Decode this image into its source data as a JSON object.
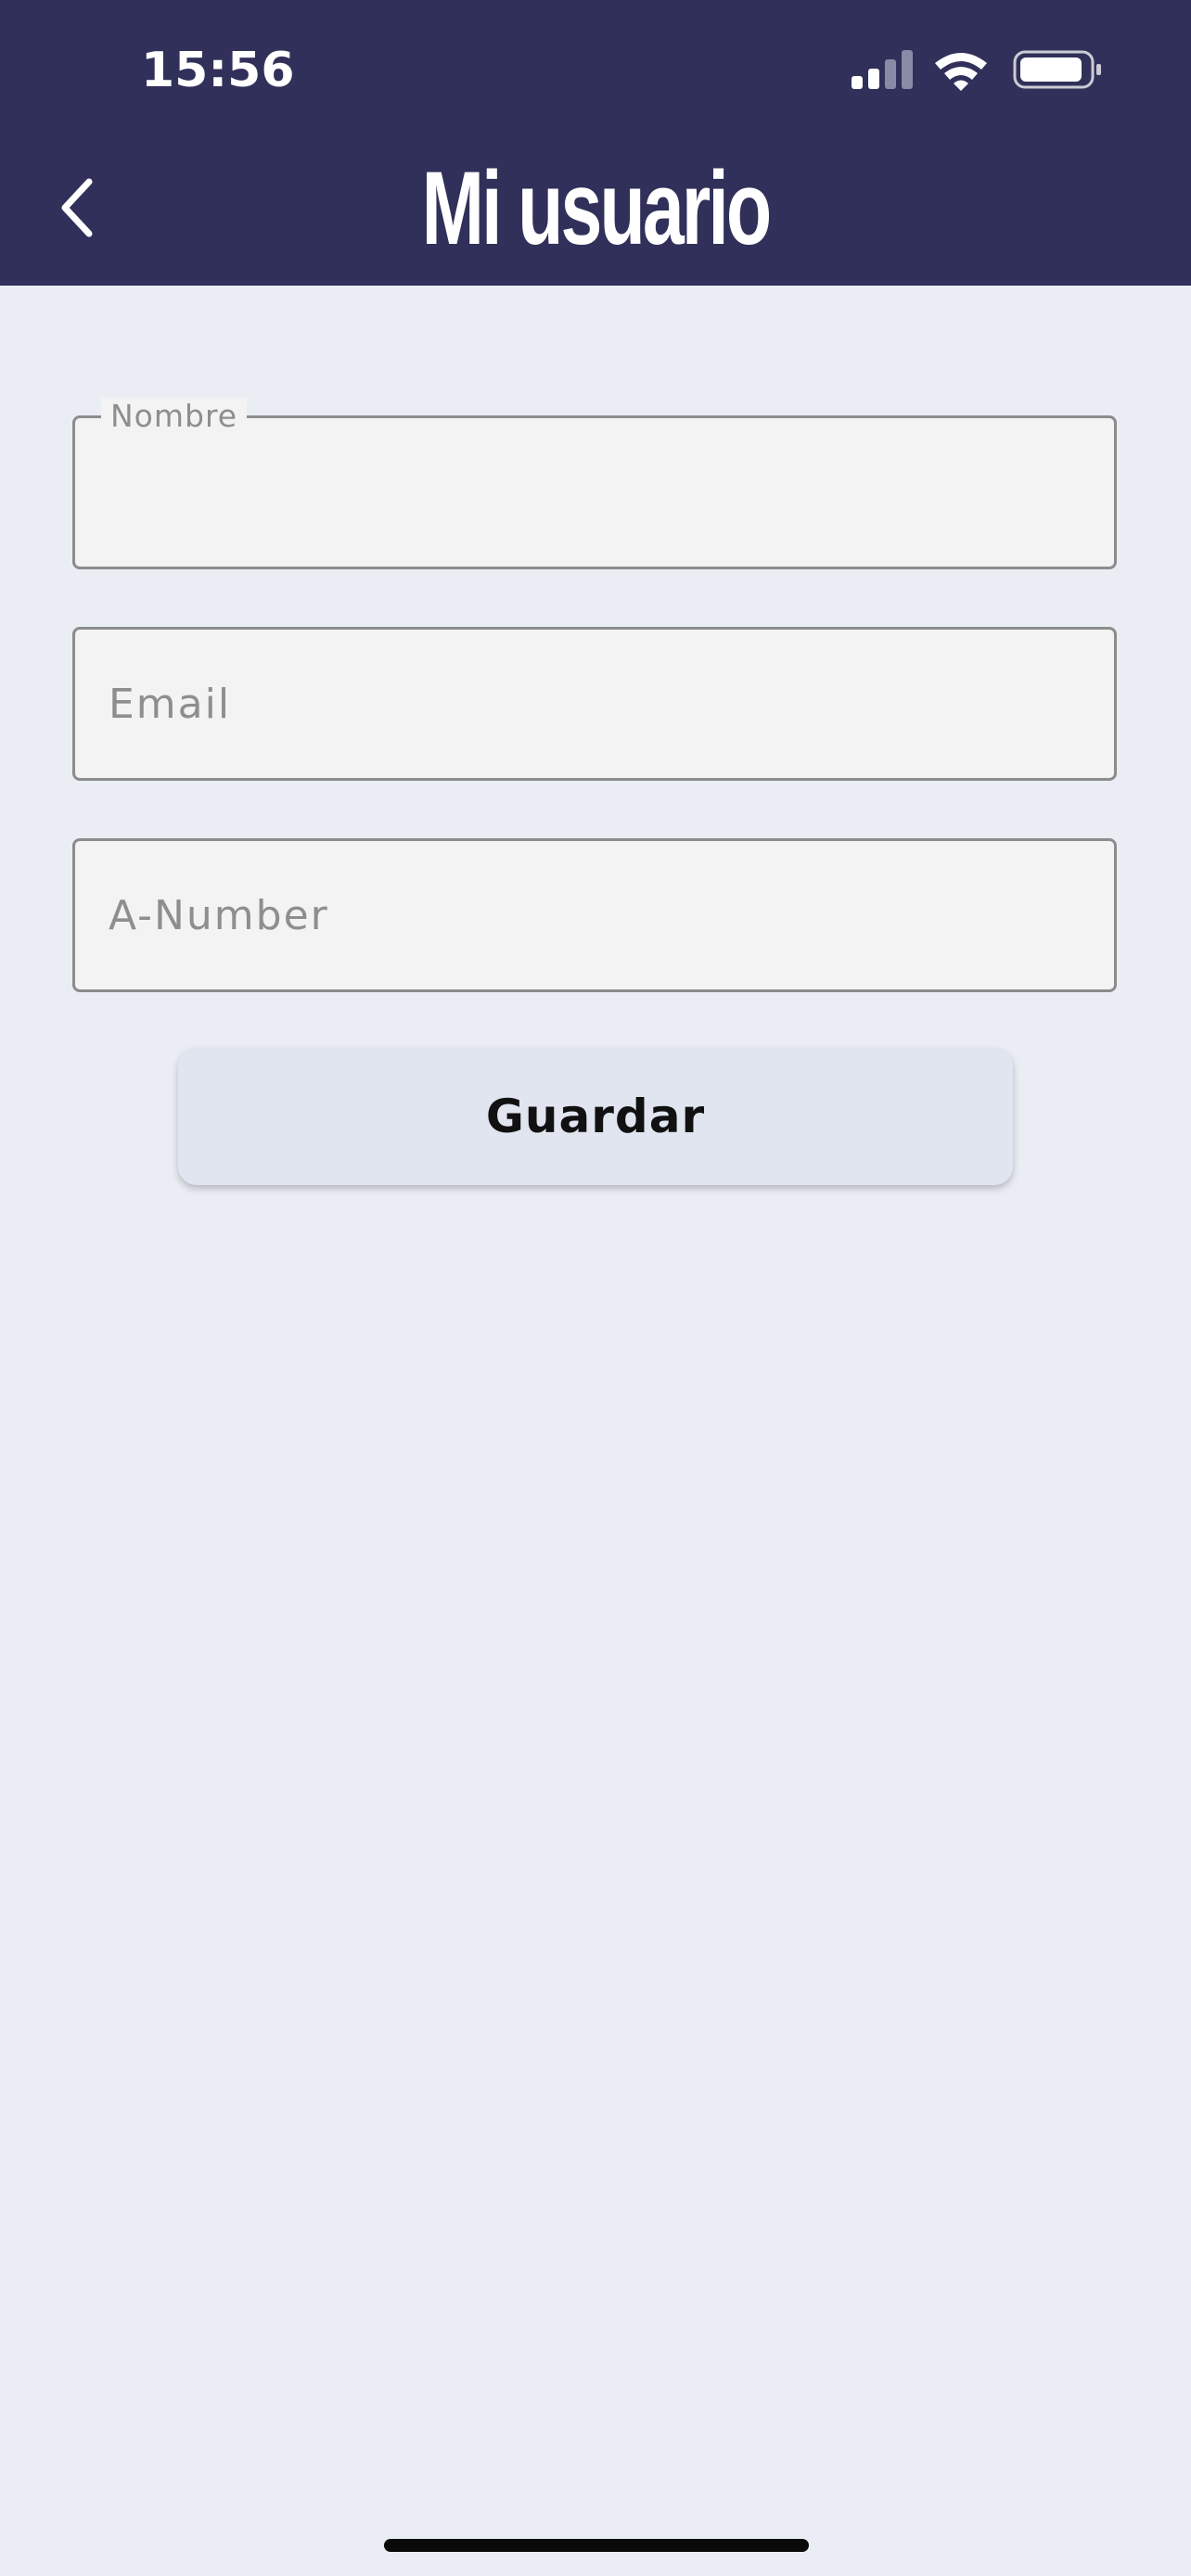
{
  "status_bar": {
    "time": "15:56",
    "icons": [
      "cellular-signal-icon",
      "wifi-icon",
      "battery-icon"
    ]
  },
  "header": {
    "back_icon": "chevron-left-icon",
    "title": "Mi usuario"
  },
  "form": {
    "name": {
      "label": "Nombre",
      "value": ""
    },
    "email": {
      "placeholder": "Email",
      "value": ""
    },
    "a_number": {
      "placeholder": "A-Number",
      "value": ""
    },
    "save_label": "Guardar"
  },
  "colors": {
    "header_bg": "#30305a",
    "page_bg": "#ebedf5",
    "field_bg": "#f3f3f3",
    "button_bg": "#e0e5f0"
  }
}
